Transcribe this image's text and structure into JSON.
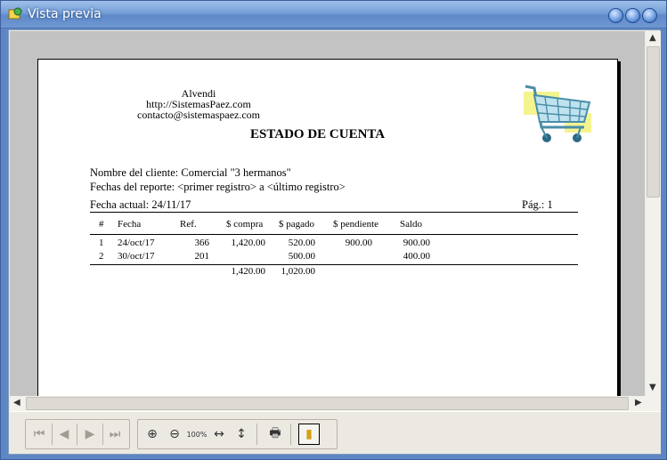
{
  "window": {
    "title": "Vista previa",
    "accent": "#5f86c4"
  },
  "report": {
    "company_name": "Alvendi",
    "company_web": "http://SistemasPaez.com",
    "company_email": "contacto@sistemaspaez.com",
    "title": "ESTADO DE CUENTA",
    "client_line": "Nombre del cliente: Comercial \"3 hermanos\"",
    "dates_line": "Fechas del reporte: <primer registro>  a  <último registro>",
    "current_date": "Fecha actual: 24/11/17",
    "page_label": "Pág.: 1",
    "columns": [
      "#",
      "Fecha",
      "Ref.",
      "$ compra",
      "$ pagado",
      "$ pendiente",
      "Saldo"
    ],
    "rows": [
      {
        "num": "1",
        "date": "24/oct/17",
        "ref": "366",
        "compra": "1,420.00",
        "pagado": "520.00",
        "pendiente": "900.00",
        "saldo": "900.00"
      },
      {
        "num": "2",
        "date": "30/oct/17",
        "ref": "201",
        "compra": "",
        "pagado": "500.00",
        "pendiente": "",
        "saldo": "400.00"
      }
    ],
    "totals": {
      "compra": "1,420.00",
      "pagado": "1,020.00"
    }
  },
  "toolbar": {
    "buttons": [
      {
        "name": "first-page-button",
        "icon": "first-page-icon",
        "glyph": "⏮",
        "enabled": false
      },
      {
        "name": "prev-page-button",
        "icon": "prev-page-icon",
        "glyph": "◀",
        "enabled": false
      },
      {
        "name": "next-page-button",
        "icon": "next-page-icon",
        "glyph": "▶",
        "enabled": false
      },
      {
        "name": "last-page-button",
        "icon": "last-page-icon",
        "glyph": "⏭",
        "enabled": false
      },
      {
        "name": "zoom-in-button",
        "icon": "zoom-in-icon",
        "glyph": "⊕"
      },
      {
        "name": "zoom-out-button",
        "icon": "zoom-out-icon",
        "glyph": "⊖"
      },
      {
        "name": "zoom-100-button",
        "icon": "zoom-100-icon",
        "glyph": "100%"
      },
      {
        "name": "fit-width-button",
        "icon": "fit-width-icon",
        "glyph": "↔"
      },
      {
        "name": "fit-page-button",
        "icon": "fit-page-icon",
        "glyph": "↕"
      },
      {
        "name": "print-button",
        "icon": "printer-icon",
        "glyph": "🖶"
      },
      {
        "name": "close-preview-button",
        "icon": "exit-door-icon",
        "glyph": "▮"
      }
    ]
  }
}
